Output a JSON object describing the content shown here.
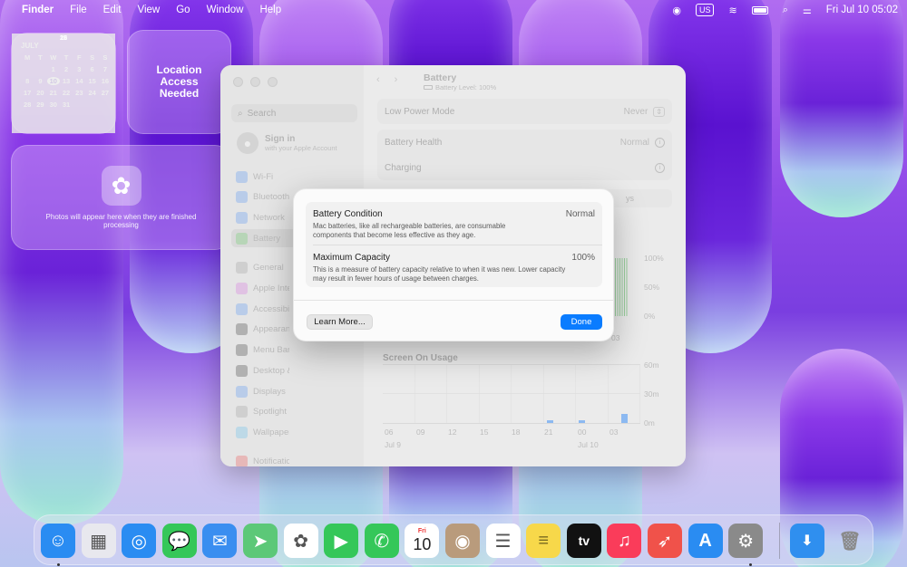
{
  "menubar": {
    "app_name": "Finder",
    "items": [
      "File",
      "Edit",
      "View",
      "Go",
      "Window",
      "Help"
    ],
    "keyboard": "US",
    "datetime": "Fri Jul 10  05:02"
  },
  "calendar_widget": {
    "month": "JULY",
    "weekdays": [
      "M",
      "T",
      "W",
      "T",
      "F",
      "S",
      "S"
    ],
    "days": [
      "1",
      "2",
      "3",
      "4",
      "5",
      "6",
      "7",
      "8",
      "9",
      "10",
      "11",
      "12",
      "13",
      "14",
      "15",
      "16",
      "17",
      "18",
      "19",
      "20",
      "21",
      "22",
      "23",
      "24",
      "25",
      "26",
      "27",
      "28",
      "29",
      "30",
      "31"
    ],
    "today": "10"
  },
  "location_widget": {
    "text": "Location Access Needed"
  },
  "photos_widget": {
    "text": "Photos will appear here when they are finished processing"
  },
  "settings": {
    "search_placeholder": "Search",
    "signin_title": "Sign in",
    "signin_sub": "with your Apple Account",
    "sidebar": [
      {
        "label": "Wi-Fi",
        "color": "#4c8ef0"
      },
      {
        "label": "Bluetooth",
        "color": "#4c8ef0"
      },
      {
        "label": "Network",
        "color": "#4c8ef0"
      },
      {
        "label": "Battery",
        "color": "#5cc35c"
      },
      {
        "label": "General",
        "color": "#9a9a9a"
      },
      {
        "label": "Apple Intelligence & Siri",
        "color": "#d06adc"
      },
      {
        "label": "Accessibility",
        "color": "#4c8ef0"
      },
      {
        "label": "Appearance",
        "color": "#333333"
      },
      {
        "label": "Menu Bar",
        "color": "#333333"
      },
      {
        "label": "Desktop & Dock",
        "color": "#333333"
      },
      {
        "label": "Displays",
        "color": "#4c8ef0"
      },
      {
        "label": "Spotlight",
        "color": "#9a9a9a"
      },
      {
        "label": "Wallpaper",
        "color": "#5ab8e8"
      },
      {
        "label": "Notifications",
        "color": "#e84a4a"
      }
    ],
    "title": "Battery",
    "subtitle": "Battery Level: 100%",
    "low_power_label": "Low Power Mode",
    "low_power_value": "Never",
    "health_label": "Battery Health",
    "health_value": "Normal",
    "charging_label": "Charging",
    "partial_tab": "ys",
    "level_ticks": [
      "100%",
      "50%",
      "0%"
    ],
    "level_partial_x": "03",
    "screen_usage_title": "Screen On Usage",
    "usage_ticks": [
      "60m",
      "30m",
      "0m"
    ],
    "usage_x": [
      "06",
      "09",
      "12",
      "15",
      "18",
      "21",
      "00",
      "03"
    ],
    "usage_dates": [
      "Jul 9",
      "Jul 10"
    ]
  },
  "dialog": {
    "condition_title": "Battery Condition",
    "condition_value": "Normal",
    "condition_desc": "Mac batteries, like all rechargeable batteries, are consumable components that become less effective as they age.",
    "capacity_title": "Maximum Capacity",
    "capacity_value": "100%",
    "capacity_desc": "This is a measure of battery capacity relative to when it was new. Lower capacity may result in fewer hours of usage between charges.",
    "learn_more": "Learn More...",
    "done": "Done"
  },
  "dock": {
    "apps": [
      {
        "name": "finder",
        "color": "#2a8cf2",
        "glyph": "☺"
      },
      {
        "name": "launchpad",
        "color": "#e8e8ee",
        "glyph": "▦"
      },
      {
        "name": "safari",
        "color": "#2a8cf2",
        "glyph": "◎"
      },
      {
        "name": "messages",
        "color": "#35c759",
        "glyph": "💬"
      },
      {
        "name": "mail",
        "color": "#3a8ef0",
        "glyph": "✉"
      },
      {
        "name": "maps",
        "color": "#5cc878",
        "glyph": "➤"
      },
      {
        "name": "photos",
        "color": "#ffffff",
        "glyph": "✿"
      },
      {
        "name": "facetime",
        "color": "#35c759",
        "glyph": "▶"
      },
      {
        "name": "phone",
        "color": "#35c759",
        "glyph": "✆"
      },
      {
        "name": "calendar",
        "color": "#ffffff",
        "glyph": ""
      },
      {
        "name": "contacts",
        "color": "#b99b7c",
        "glyph": "◉"
      },
      {
        "name": "reminders",
        "color": "#ffffff",
        "glyph": "☰"
      },
      {
        "name": "notes",
        "color": "#f7d84a",
        "glyph": "≡"
      },
      {
        "name": "tv",
        "color": "#111111",
        "glyph": "tv"
      },
      {
        "name": "music",
        "color": "#fa3c5a",
        "glyph": "♫"
      },
      {
        "name": "launch",
        "color": "#f0524a",
        "glyph": "➶"
      },
      {
        "name": "app-store",
        "color": "#2a8cf2",
        "glyph": "A"
      },
      {
        "name": "system-settings",
        "color": "#8a8a8a",
        "glyph": "⚙"
      }
    ],
    "calendar_day_name": "Fri",
    "calendar_day_num": "10"
  }
}
